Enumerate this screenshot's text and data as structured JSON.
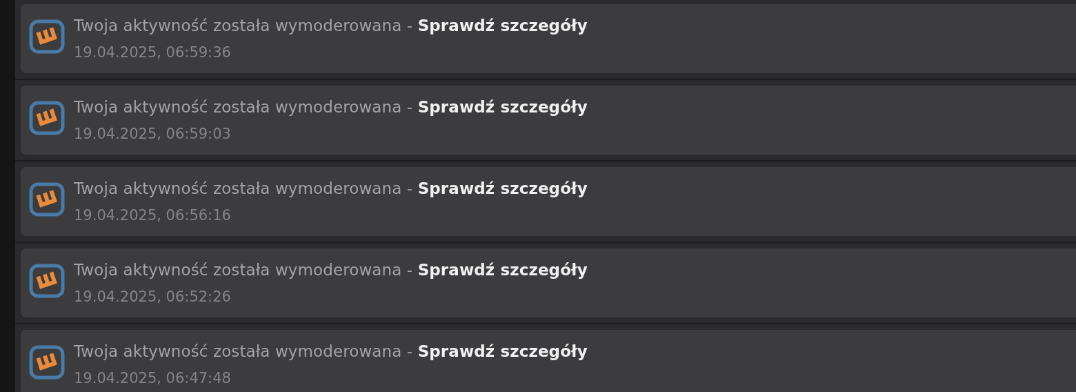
{
  "notifications": [
    {
      "message": "Twoja aktywność została wymoderowana - ",
      "link": "Sprawdź szczegóły",
      "time": "19.04.2025, 06:59:36"
    },
    {
      "message": "Twoja aktywność została wymoderowana - ",
      "link": "Sprawdź szczegóły",
      "time": "19.04.2025, 06:59:03"
    },
    {
      "message": "Twoja aktywność została wymoderowana - ",
      "link": "Sprawdź szczegóły",
      "time": "19.04.2025, 06:56:16"
    },
    {
      "message": "Twoja aktywność została wymoderowana - ",
      "link": "Sprawdź szczegóły",
      "time": "19.04.2025, 06:52:26"
    },
    {
      "message": "Twoja aktywność została wymoderowana - ",
      "link": "Sprawdź szczegóły",
      "time": "19.04.2025, 06:47:48"
    }
  ]
}
